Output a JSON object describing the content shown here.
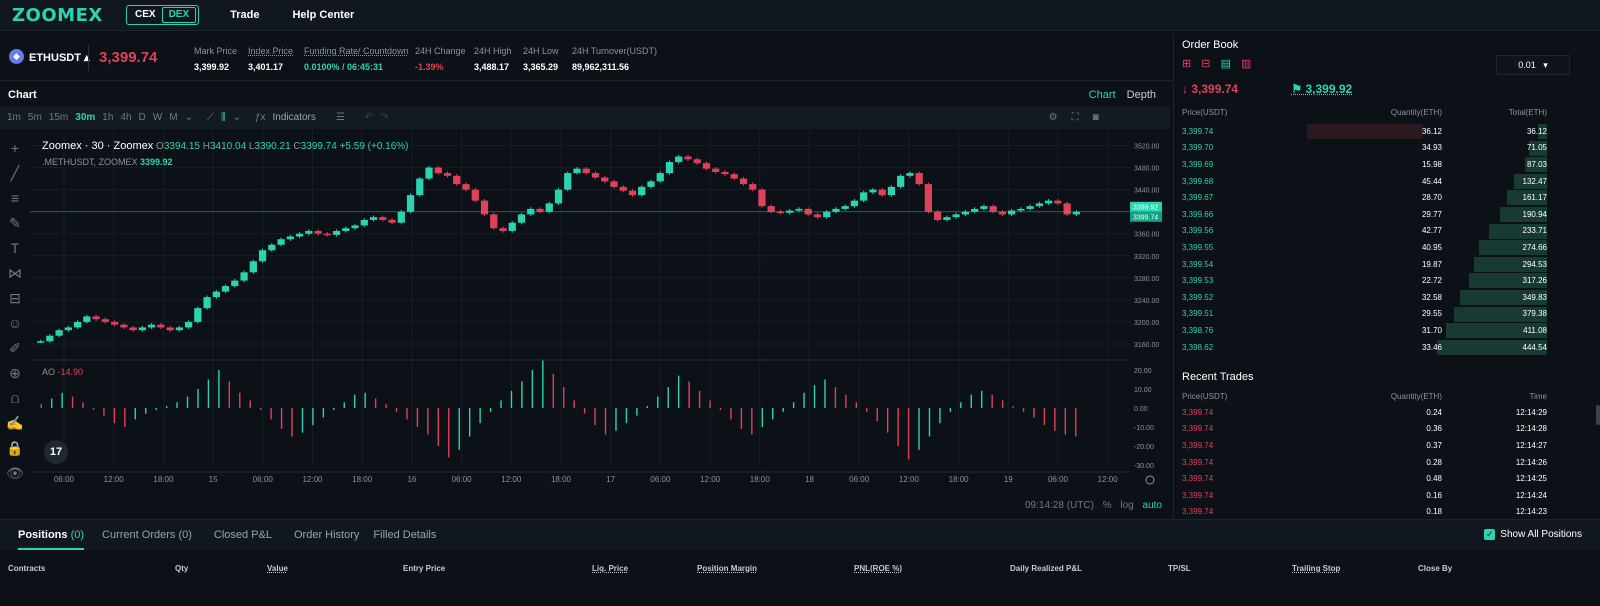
{
  "topbar": {
    "logo": "ZOOMEX",
    "cex": "CEX",
    "dex": "DEX",
    "nav": [
      "Trade",
      "Help Center"
    ]
  },
  "ticker": {
    "symbol": "ETHUSDT",
    "last_price": "3,399.74",
    "stats": [
      {
        "label": "Mark Price",
        "value": "3,399.92"
      },
      {
        "label": "Index Price",
        "value": "3,401.17"
      },
      {
        "label": "Funding Rate/ Countdown",
        "value": "0.0100% / 06:45:31"
      },
      {
        "label": "24H Change",
        "value": "-1.39%"
      },
      {
        "label": "24H High",
        "value": "3,488.17"
      },
      {
        "label": "24H Low",
        "value": "3,365.29"
      },
      {
        "label": "24H Turnover(USDT)",
        "value": "89,962,311.56"
      }
    ]
  },
  "chart": {
    "title": "Chart",
    "tabs": [
      "Chart",
      "Depth"
    ],
    "intervals": [
      "1m",
      "5m",
      "15m",
      "30m",
      "1h",
      "4h",
      "D",
      "W",
      "M"
    ],
    "active_interval": "30m",
    "indicators_label": "Indicators",
    "ohlc": {
      "name": "Zoomex · 30 · Zoomex",
      "o": "3394.15",
      "h": "3410.04",
      "l": "3390.21",
      "c": "3399.74",
      "chg": "+5.59 (+0.16%)"
    },
    "sub": {
      "name": ".METHUSDT, ZOOMEX",
      "value": "3399.92"
    },
    "ao": {
      "name": "AO",
      "value": "-14.90"
    },
    "tv_logo": "17",
    "footer": {
      "time": "09:14:28 (UTC)",
      "pct": "%",
      "log": "log",
      "auto": "auto"
    },
    "price_tags": [
      "3399.92",
      "3399.74"
    ]
  },
  "chart_data": {
    "type": "line",
    "xlabel": "",
    "ylabel": "",
    "x_ticks": [
      "06:00",
      "12:00",
      "18:00",
      "15",
      "06:00",
      "12:00",
      "18:00",
      "16",
      "06:00",
      "12:00",
      "18:00",
      "17",
      "06:00",
      "12:00",
      "18:00",
      "18",
      "06:00",
      "12:00",
      "18:00",
      "19",
      "06:00",
      "12:00"
    ],
    "y_ticks": [
      3520,
      3480,
      3440,
      3400,
      3360,
      3320,
      3280,
      3240,
      3200,
      3160
    ],
    "ylim": [
      3140,
      3530
    ],
    "series": [
      {
        "name": "",
        "values": [
          3165,
          3175,
          3185,
          3190,
          3200,
          3210,
          3205,
          3200,
          3195,
          3190,
          3185,
          3190,
          3195,
          3190,
          3185,
          3190,
          3200,
          3225,
          3245,
          3255,
          3265,
          3275,
          3290,
          3310,
          3330,
          3340,
          3350,
          3355,
          3360,
          3365,
          3360,
          3358,
          3365,
          3370,
          3375,
          3385,
          3390,
          3385,
          3380,
          3400,
          3430,
          3460,
          3480,
          3470,
          3465,
          3450,
          3440,
          3420,
          3395,
          3370,
          3365,
          3380,
          3395,
          3405,
          3400,
          3415,
          3440,
          3470,
          3478,
          3470,
          3462,
          3455,
          3445,
          3438,
          3430,
          3445,
          3455,
          3470,
          3490,
          3500,
          3495,
          3488,
          3478,
          3472,
          3468,
          3460,
          3450,
          3440,
          3410,
          3400,
          3398,
          3402,
          3405,
          3395,
          3390,
          3400,
          3405,
          3410,
          3420,
          3435,
          3440,
          3430,
          3445,
          3465,
          3470,
          3450,
          3400,
          3385,
          3390,
          3395,
          3400,
          3405,
          3410,
          3400,
          3395,
          3402,
          3405,
          3410,
          3415,
          3420,
          3415,
          3395,
          3399.74
        ]
      }
    ],
    "ao_ylim": [
      -30,
      20
    ],
    "ao_ticks": [
      20,
      10,
      0,
      -10,
      -20,
      -30
    ],
    "ao_values": [
      2,
      5,
      8,
      6,
      3,
      -1,
      -4,
      -8,
      -10,
      -6,
      -3,
      -1,
      1,
      3,
      6,
      10,
      15,
      20,
      14,
      8,
      4,
      -1,
      -6,
      -11,
      -15,
      -13,
      -9,
      -5,
      -1,
      3,
      7,
      8,
      5,
      2,
      -2,
      -6,
      -10,
      -14,
      -20,
      -26,
      -22,
      -15,
      -8,
      -2,
      4,
      9,
      14,
      20,
      25,
      18,
      11,
      4,
      -3,
      -9,
      -14,
      -12,
      -8,
      -4,
      1,
      6,
      11,
      17,
      14,
      9,
      4,
      -1,
      -6,
      -11,
      -14,
      -10,
      -6,
      -2,
      3,
      8,
      12,
      15,
      11,
      7,
      3,
      -2,
      -7,
      -13,
      -20,
      -27,
      -22,
      -15,
      -8,
      -2,
      3,
      7,
      9,
      7,
      4,
      1,
      -2,
      -5,
      -9,
      -12,
      -14,
      -15
    ]
  },
  "left_tools": [
    "+",
    "╱",
    "≡",
    "✎",
    "T",
    "⋈",
    "⊟",
    "☺",
    "✐",
    "⊕",
    "⩍",
    "✍",
    "🔒",
    "👁"
  ],
  "orderbook": {
    "title": "Order Book",
    "step": "0.01",
    "last_price": "3,399.74",
    "mark_price": "3,399.92",
    "headers": [
      "Price(USDT)",
      "Quantity(ETH)",
      "Total(ETH)"
    ],
    "rows": [
      {
        "price": "3,399.74",
        "qty": "36.12",
        "total": "36.12",
        "depth": 0.08
      },
      {
        "price": "3,399.70",
        "qty": "34.93",
        "total": "71.05",
        "depth": 0.16
      },
      {
        "price": "3,399.69",
        "qty": "15.98",
        "total": "87.03",
        "depth": 0.2
      },
      {
        "price": "3,399.68",
        "qty": "45.44",
        "total": "132.47",
        "depth": 0.3
      },
      {
        "price": "3,399.67",
        "qty": "28.70",
        "total": "161.17",
        "depth": 0.36
      },
      {
        "price": "3,399.66",
        "qty": "29.77",
        "total": "190.94",
        "depth": 0.43
      },
      {
        "price": "3,399.56",
        "qty": "42.77",
        "total": "233.71",
        "depth": 0.53
      },
      {
        "price": "3,399.55",
        "qty": "40.95",
        "total": "274.66",
        "depth": 0.62
      },
      {
        "price": "3,399.54",
        "qty": "19.87",
        "total": "294.53",
        "depth": 0.66
      },
      {
        "price": "3,399.53",
        "qty": "22.72",
        "total": "317.26",
        "depth": 0.71
      },
      {
        "price": "3,399.52",
        "qty": "32.58",
        "total": "349.83",
        "depth": 0.79
      },
      {
        "price": "3,399.51",
        "qty": "29.55",
        "total": "379.38",
        "depth": 0.85
      },
      {
        "price": "3,398.76",
        "qty": "31.70",
        "total": "411.08",
        "depth": 0.92
      },
      {
        "price": "3,398.62",
        "qty": "33.46",
        "total": "444.54",
        "depth": 1.0
      }
    ]
  },
  "recent_trades": {
    "title": "Recent Trades",
    "headers": [
      "Price(USDT)",
      "Quantity(ETH)",
      "Time"
    ],
    "rows": [
      {
        "price": "3,399.74",
        "qty": "0.24",
        "time": "12:14:29"
      },
      {
        "price": "3,399.74",
        "qty": "0.36",
        "time": "12:14:28"
      },
      {
        "price": "3,399.74",
        "qty": "0.37",
        "time": "12:14:27"
      },
      {
        "price": "3,399.74",
        "qty": "0.28",
        "time": "12:14:26"
      },
      {
        "price": "3,399.74",
        "qty": "0.48",
        "time": "12:14:25"
      },
      {
        "price": "3,399.74",
        "qty": "0.16",
        "time": "12:14:24"
      },
      {
        "price": "3,399.74",
        "qty": "0.18",
        "time": "12:14:23"
      }
    ]
  },
  "positions": {
    "tabs": [
      {
        "label": "Positions",
        "count": "(0)"
      },
      {
        "label": "Current Orders",
        "count": "(0)"
      },
      {
        "label": "Closed P&L",
        "count": ""
      },
      {
        "label": "Order History",
        "count": ""
      },
      {
        "label": "Filled Details",
        "count": ""
      }
    ],
    "show_all": "Show All Positions",
    "columns": [
      "Contracts",
      "Qty",
      "Value",
      "Entry Price",
      "Liq. Price",
      "Position Margin",
      "PNL(ROE %)",
      "Daily Realized P&L",
      "TP/SL",
      "Trailing Stop",
      "Close By"
    ]
  },
  "colors": {
    "accent": "#2bd4b0",
    "down": "#e0415a",
    "bg": "#0b1117"
  }
}
